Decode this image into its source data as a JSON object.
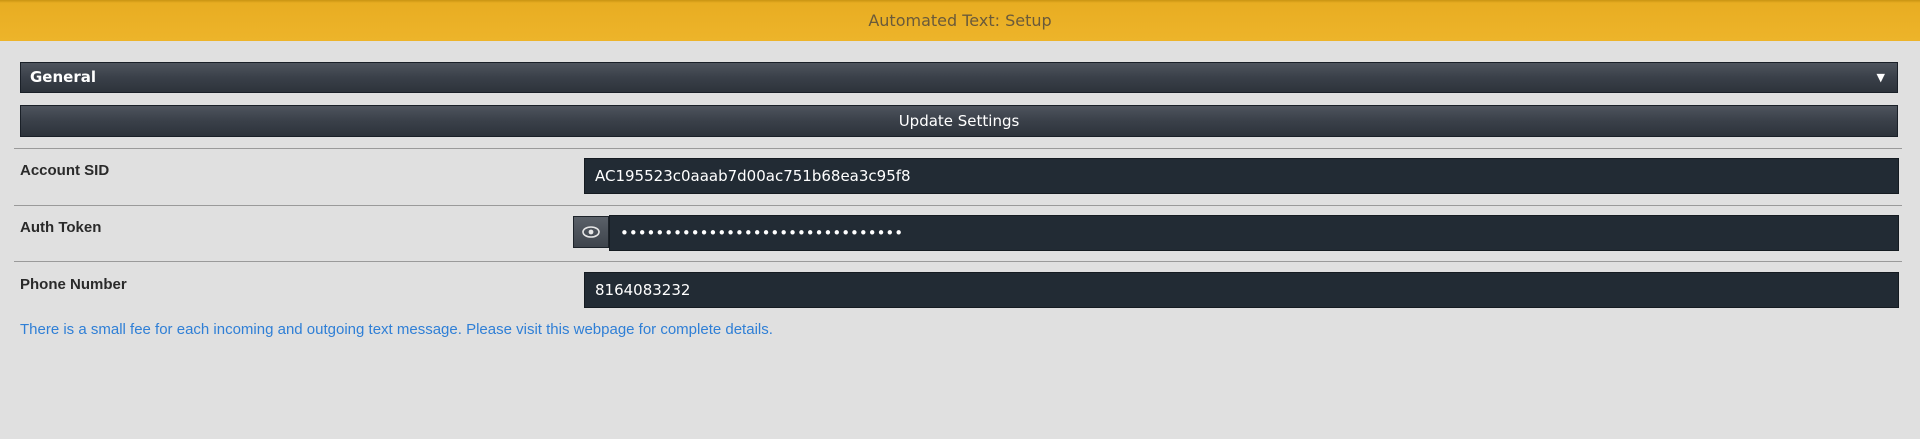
{
  "header": {
    "title": "Automated Text: Setup"
  },
  "settings": {
    "category_select": {
      "selected": "General"
    },
    "update_label": "Update Settings"
  },
  "fields": {
    "account_sid": {
      "label": "Account SID",
      "value": "AC195523c0aaab7d00ac751b68ea3c95f8"
    },
    "auth_token": {
      "label": "Auth Token",
      "masked_value": "••••••••••••••••••••••••••••••••"
    },
    "phone_number": {
      "label": "Phone Number",
      "value": "8164083232"
    }
  },
  "note": {
    "text": "There is a small fee for each incoming and outgoing text message. Please visit this webpage for complete details."
  },
  "icons": {
    "caret": "caret-down-icon",
    "reveal": "eye-icon"
  },
  "colors": {
    "header_bg": "#edb42a",
    "input_bg": "#222b34",
    "link": "#2f7fd6"
  }
}
